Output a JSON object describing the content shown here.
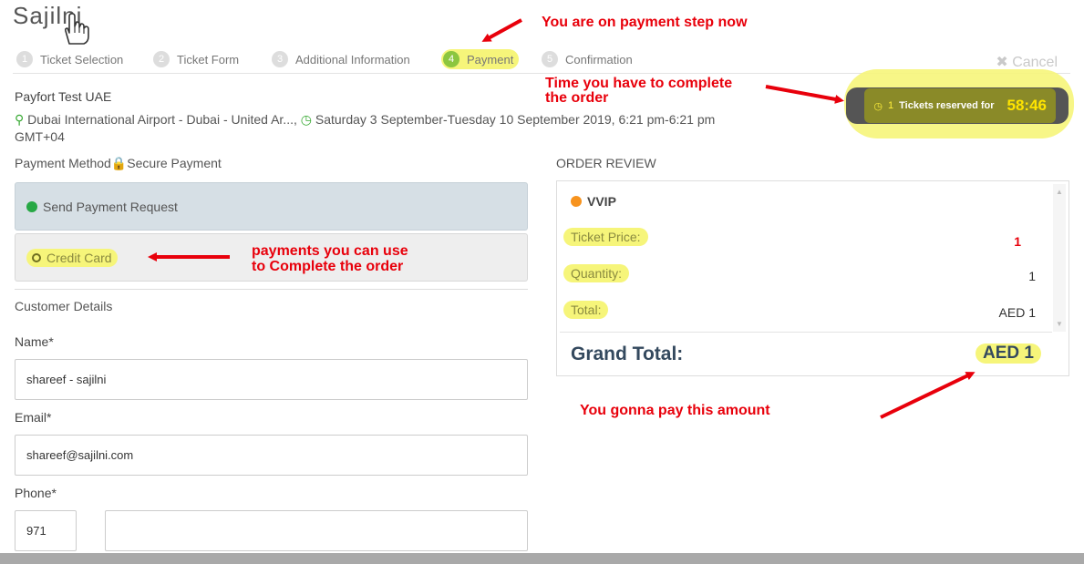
{
  "logo": {
    "text": "Sajilni"
  },
  "steps": [
    {
      "num": "1",
      "label": "Ticket Selection"
    },
    {
      "num": "2",
      "label": "Ticket Form"
    },
    {
      "num": "3",
      "label": "Additional Information"
    },
    {
      "num": "4",
      "label": "Payment"
    },
    {
      "num": "5",
      "label": "Confirmation"
    }
  ],
  "cancel_label": "✖ Cancel",
  "event": {
    "title": "Payfort Test UAE",
    "location": "Dubai International Airport - Dubai - United Ar...,",
    "datetime": "Saturday 3 September-Tuesday 10 September 2019, 6:21 pm-6:21 pm",
    "timezone": "GMT+04"
  },
  "timer": {
    "count": "1",
    "label": "Tickets reserved for",
    "time": "58:46"
  },
  "payment": {
    "title": "Payment Method",
    "secure": "Secure Payment",
    "options": [
      "Send Payment Request",
      "Credit Card"
    ]
  },
  "customer": {
    "title": "Customer Details",
    "name_label": "Name*",
    "name_value": "shareef - sajilni",
    "email_label": "Email*",
    "email_value": "shareef@sajilni.com",
    "phone_label": "Phone*",
    "phone_code": "971",
    "phone_value": ""
  },
  "order": {
    "title": "ORDER REVIEW",
    "ticket_name": "VVIP",
    "price_label": "Ticket Price:",
    "price_value": "1",
    "qty_label": "Quantity:",
    "qty_value": "1",
    "total_label": "Total:",
    "total_value": "AED 1",
    "grand_label": "Grand Total:",
    "grand_value": "AED 1"
  },
  "annotations": {
    "step": "You are on payment step now",
    "timer_line1": "Time you have to complete",
    "timer_line2": "the order",
    "payments_line1": "payments you can use",
    "payments_line2": "to Complete the order",
    "amount": "You gonna pay this amount"
  },
  "colors": {
    "highlight": "#f6f57a",
    "annotation": "#e8000b",
    "active_step": "#8cc63f",
    "grand_total": "#34495e"
  }
}
